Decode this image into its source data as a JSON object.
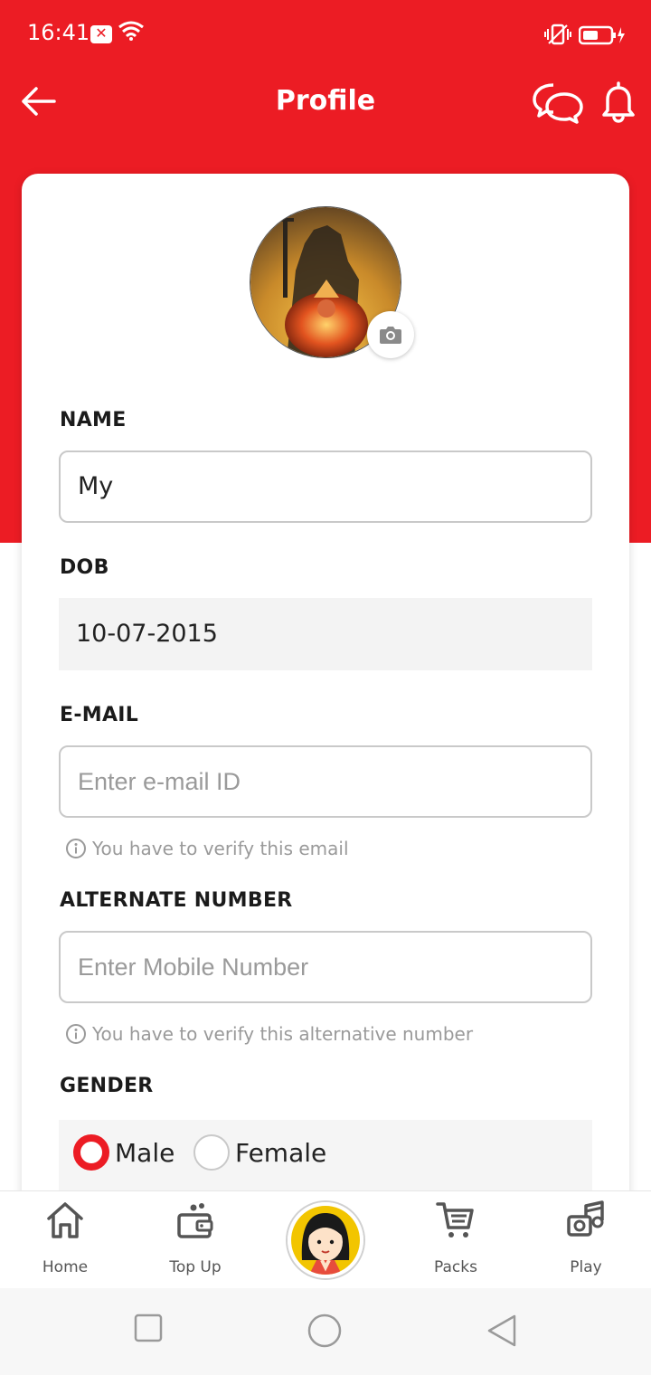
{
  "status_bar": {
    "time": "16:41",
    "notif_badge": "✕"
  },
  "header": {
    "title": "Profile"
  },
  "form": {
    "name_label": "NAME",
    "name_value": "My",
    "dob_label": "DOB",
    "dob_value": "10-07-2015",
    "email_label": "E-MAIL",
    "email_placeholder": "Enter e-mail ID",
    "email_hint": "You have to verify this email",
    "alt_label": "ALTERNATE NUMBER",
    "alt_placeholder": "Enter Mobile Number",
    "alt_hint": "You have to verify this alternative number",
    "gender_label": "GENDER",
    "gender_options": [
      "Male",
      "Female"
    ],
    "gender_selected": "Male"
  },
  "bottom_nav": {
    "items": [
      {
        "label": "Home",
        "icon": "home-icon"
      },
      {
        "label": "Top Up",
        "icon": "wallet-icon"
      },
      {
        "label": "",
        "icon": "avatar-character"
      },
      {
        "label": "Packs",
        "icon": "cart-icon"
      },
      {
        "label": "Play",
        "icon": "music-icon"
      }
    ]
  },
  "colors": {
    "accent": "#ec1c24",
    "card": "#ffffff",
    "muted": "#9a9a9a"
  }
}
